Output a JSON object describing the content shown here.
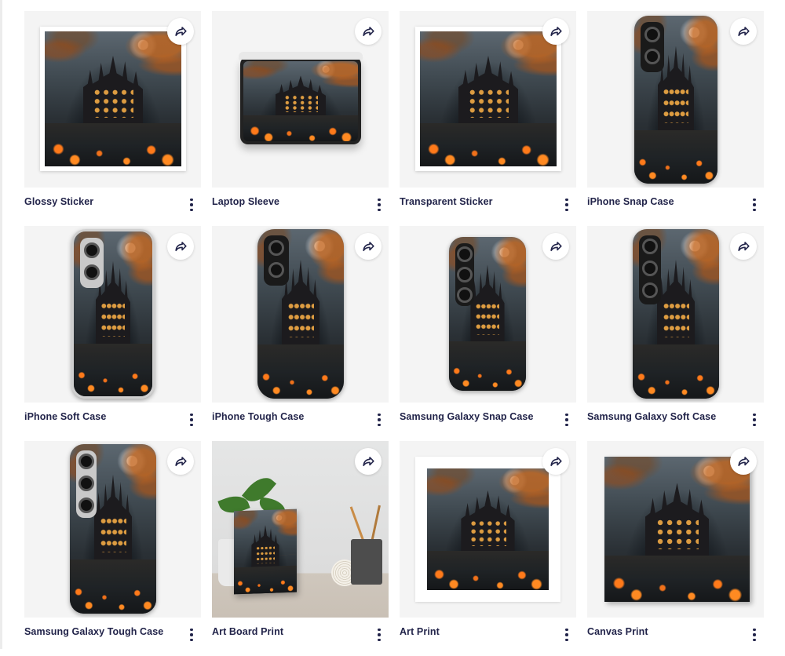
{
  "products": [
    {
      "title": "Glossy Sticker"
    },
    {
      "title": "Laptop Sleeve"
    },
    {
      "title": "Transparent Sticker"
    },
    {
      "title": "iPhone Snap Case"
    },
    {
      "title": "iPhone Soft Case"
    },
    {
      "title": "iPhone Tough Case"
    },
    {
      "title": "Samsung Galaxy Snap Case"
    },
    {
      "title": "Samsung Galaxy Soft Case"
    },
    {
      "title": "Samsung Galaxy Tough Case"
    },
    {
      "title": "Art Board Print"
    },
    {
      "title": "Art Print"
    },
    {
      "title": "Canvas Print"
    }
  ],
  "icons": {
    "share": "share-icon",
    "more": "more-vertical-icon"
  },
  "colors": {
    "title_text": "#22244a",
    "tile_background": "#f4f4f4",
    "pumpkin_orange": "#ff7a1a"
  }
}
